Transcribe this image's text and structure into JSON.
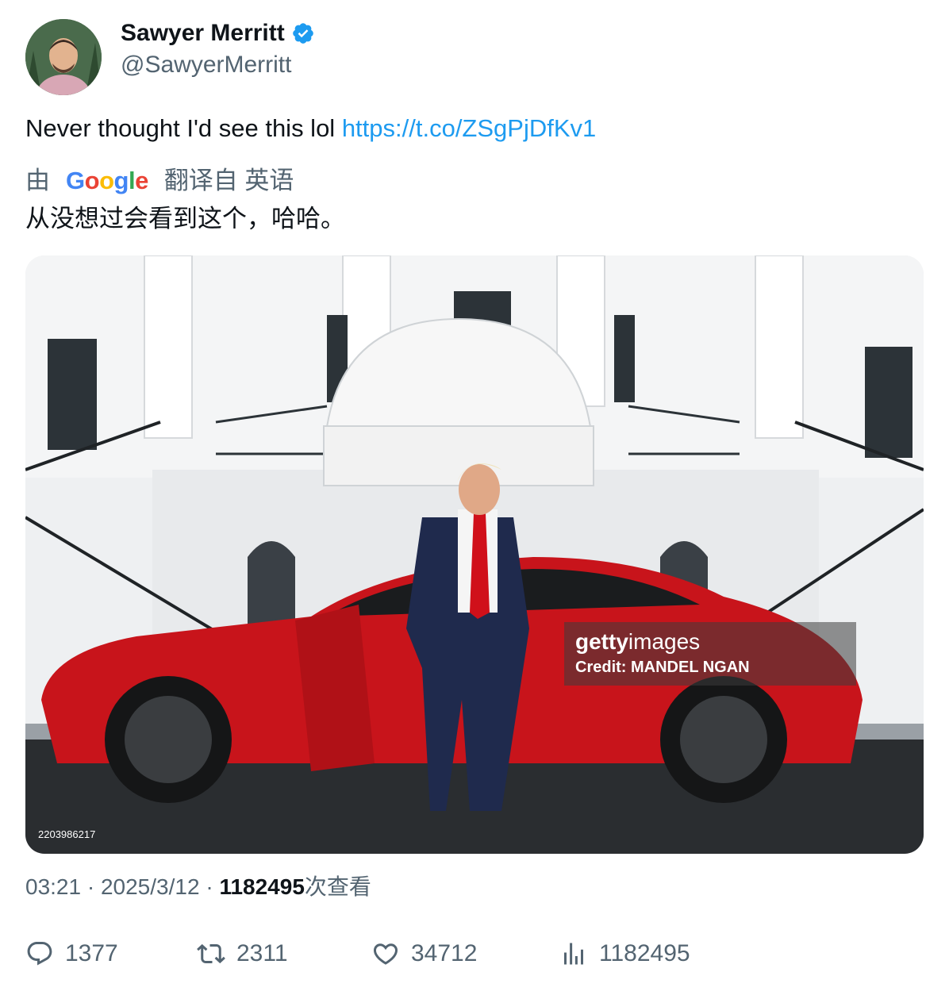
{
  "author": {
    "name": "Sawyer Merritt",
    "handle": "@SawyerMerritt",
    "avatar_icon": "avatar"
  },
  "tweet": {
    "text": "Never thought I'd see this lol ",
    "link": "https://t.co/ZSgPjDfKv1"
  },
  "translation": {
    "prefix": "由",
    "provider": "Google",
    "label": "翻译自 英语",
    "text": "从没想过会看到这个，哈哈。"
  },
  "media": {
    "watermark_logo_bold": "getty",
    "watermark_logo_thin": "images",
    "watermark_credit": "Credit: MANDEL NGAN",
    "photo_id": "2203986217"
  },
  "meta": {
    "time": "03:21",
    "sep1": " · ",
    "date": "2025/3/12",
    "sep2": " · ",
    "views": "1182495",
    "views_label": "次查看"
  },
  "actions": {
    "replies": "1377",
    "retweets": "2311",
    "likes": "34712",
    "views": "1182495"
  },
  "colors": {
    "link": "#1d9bf0",
    "muted": "#536471",
    "verified": "#1d9bf0",
    "car_red": "#c8141b"
  }
}
